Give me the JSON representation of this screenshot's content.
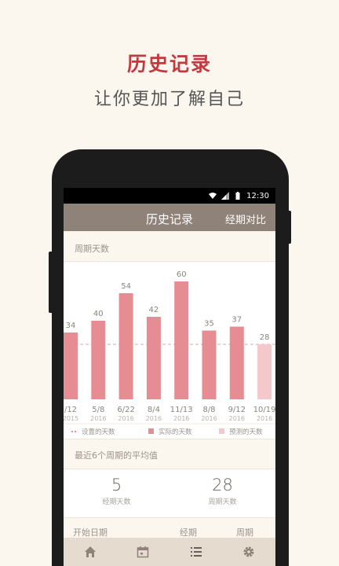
{
  "promo": {
    "title": "历史记录",
    "subtitle": "让你更加了解自己"
  },
  "status_bar": {
    "time": "12:30",
    "icons": [
      "wifi-icon",
      "signal-icon",
      "battery-icon"
    ]
  },
  "header": {
    "title": "历史记录",
    "compare_label": "经期对比"
  },
  "chart_section": {
    "label": "周期天数"
  },
  "chart_data": {
    "type": "bar",
    "categories": [
      "/12\n2015",
      "5/8\n2016",
      "6/22\n2016",
      "8/4\n2016",
      "11/13\n2016",
      "8/8\n2016",
      "9/12\n2016",
      "10/19\n2016"
    ],
    "category_dates": [
      "/12",
      "5/8",
      "6/22",
      "8/4",
      "11/13",
      "8/8",
      "9/12",
      "10/19"
    ],
    "category_years": [
      "2015",
      "2016",
      "2016",
      "2016",
      "2016",
      "2016",
      "2016",
      "2016"
    ],
    "values": [
      34,
      40,
      54,
      42,
      60,
      35,
      37,
      28
    ],
    "value_labels": [
      "34",
      "40",
      "54",
      "42",
      "60",
      "35",
      "37",
      "28"
    ],
    "bar_kinds": [
      "actual",
      "actual",
      "actual",
      "actual",
      "actual",
      "actual",
      "actual",
      "predicted"
    ],
    "reference_line": 28,
    "colors": {
      "actual": "#e68c93",
      "predicted": "#f5c9cc",
      "reference": "#e68c93"
    },
    "legend": [
      {
        "kind": "reference",
        "label": "设置的天数"
      },
      {
        "kind": "actual",
        "label": "实际的天数"
      },
      {
        "kind": "predicted",
        "label": "预测的天数"
      }
    ]
  },
  "averages": {
    "title": "最近6个周期的平均值",
    "items": [
      {
        "value": "5",
        "label": "经期天数"
      },
      {
        "value": "28",
        "label": "周期天数"
      }
    ]
  },
  "table_head": {
    "columns": [
      "开始日期",
      "经期",
      "周期"
    ]
  },
  "bottom_nav": {
    "items": [
      "home-icon",
      "calendar-icon",
      "list-icon",
      "settings-icon"
    ]
  }
}
